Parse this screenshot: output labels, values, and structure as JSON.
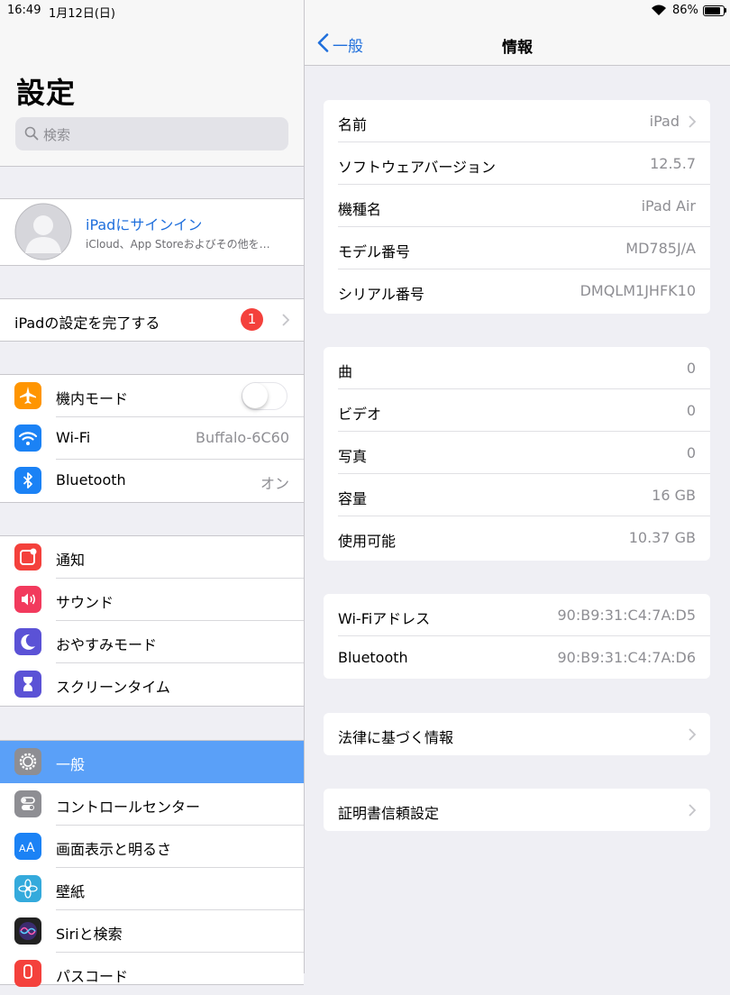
{
  "status_bar": {
    "time": "16:49",
    "date": "1月12日(日)",
    "battery": "86%",
    "battery_level": 0.86
  },
  "sidebar": {
    "title": "設定",
    "search_placeholder": "検索",
    "account": {
      "title": "iPadにサインイン",
      "subtitle": "iCloud、App Storeおよびその他を…"
    },
    "setup": {
      "label": "iPadの設定を完了する",
      "badge": "1"
    },
    "connectivity": [
      {
        "label": "機内モード",
        "toggle_on": false,
        "icon": "airplane-icon",
        "color": "#ff9500"
      },
      {
        "label": "Wi-Fi",
        "value": "Buffalo-6C60",
        "icon": "wifi-icon",
        "color": "#1b82f5"
      },
      {
        "label": "Bluetooth",
        "value": "オン",
        "icon": "bluetooth-icon",
        "color": "#1b82f5"
      }
    ],
    "notifications": [
      {
        "label": "通知",
        "icon": "notifications-icon",
        "color": "#f4413c"
      },
      {
        "label": "サウンド",
        "icon": "sound-icon",
        "color": "#f23a5d"
      },
      {
        "label": "おやすみモード",
        "icon": "moon-icon",
        "color": "#5b52d6"
      },
      {
        "label": "スクリーンタイム",
        "icon": "hourglass-icon",
        "color": "#5b52d6"
      }
    ],
    "general": [
      {
        "label": "一般",
        "icon": "gear-icon",
        "color": "#8e8e93",
        "selected": true
      },
      {
        "label": "コントロールセンター",
        "icon": "control-center-icon",
        "color": "#8e8e93"
      },
      {
        "label": "画面表示と明るさ",
        "icon": "display-icon",
        "color": "#1b82f5"
      },
      {
        "label": "壁紙",
        "icon": "wallpaper-icon",
        "color": "#34aadc"
      },
      {
        "label": "Siriと検索",
        "icon": "siri-icon",
        "color": "#222222"
      },
      {
        "label": "パスコード",
        "icon": "passcode-icon",
        "color": "#f4413c"
      }
    ]
  },
  "detail": {
    "back_label": "一般",
    "title": "情報",
    "device": [
      {
        "label": "名前",
        "value": "iPad",
        "chevron": true
      },
      {
        "label": "ソフトウェアバージョン",
        "value": "12.5.7"
      },
      {
        "label": "機種名",
        "value": "iPad Air"
      },
      {
        "label": "モデル番号",
        "value": "MD785J/A"
      },
      {
        "label": "シリアル番号",
        "value": "DMQLM1JHFK10"
      }
    ],
    "media": [
      {
        "label": "曲",
        "value": "0"
      },
      {
        "label": "ビデオ",
        "value": "0"
      },
      {
        "label": "写真",
        "value": "0"
      },
      {
        "label": "容量",
        "value": "16 GB"
      },
      {
        "label": "使用可能",
        "value": "10.37 GB"
      }
    ],
    "network": [
      {
        "label": "Wi-Fiアドレス",
        "value": "90:B9:31:C4:7A:D5"
      },
      {
        "label": "Bluetooth",
        "value": "90:B9:31:C4:7A:D6"
      }
    ],
    "legal": {
      "label": "法律に基づく情報"
    },
    "certs": {
      "label": "証明書信頼設定"
    }
  }
}
